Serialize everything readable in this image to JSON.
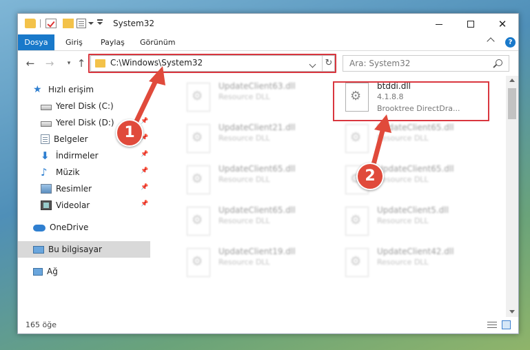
{
  "window": {
    "title": "System32",
    "min_symbol": "",
    "close_symbol": "✕"
  },
  "ribbon": {
    "tabs": [
      "Dosya",
      "Giriş",
      "Paylaş",
      "Görünüm"
    ],
    "help": "?"
  },
  "nav": {
    "back": "←",
    "forward": "→",
    "recent": "▾",
    "up": "↑",
    "address": "C:\\Windows\\System32",
    "refresh": "↻",
    "search_placeholder": "Ara: System32"
  },
  "sidebar": {
    "items": [
      {
        "label": "Hızlı erişim",
        "icon": "star-icon"
      },
      {
        "label": "Yerel Disk (C:)",
        "icon": "disk-icon"
      },
      {
        "label": "Yerel Disk (D:)",
        "icon": "disk-icon",
        "pinned": true
      },
      {
        "label": "Belgeler",
        "icon": "documents-icon",
        "pinned": true
      },
      {
        "label": "İndirmeler",
        "icon": "downloads-icon",
        "pinned": true
      },
      {
        "label": "Müzik",
        "icon": "music-icon",
        "pinned": true
      },
      {
        "label": "Resimler",
        "icon": "pictures-icon",
        "pinned": true
      },
      {
        "label": "Videolar",
        "icon": "videos-icon",
        "pinned": true
      },
      {
        "label": "OneDrive",
        "icon": "onedrive-icon"
      },
      {
        "label": "Bu bilgisayar",
        "icon": "this-pc-icon",
        "selected": true
      },
      {
        "label": "Ağ",
        "icon": "network-icon"
      }
    ],
    "pin_glyph": "📌"
  },
  "files": {
    "highlighted": {
      "name": "btddi.dll",
      "version": "4.1.8.8",
      "description": "Brooktree DirectDra..."
    },
    "left_column": [
      {
        "name": "UpdateClient63.dll",
        "type": "Resource DLL"
      },
      {
        "name": "UpdateClient21.dll",
        "type": "Resource DLL"
      },
      {
        "name": "UpdateClient65.dll",
        "type": "Resource DLL"
      },
      {
        "name": "UpdateClient65.dll",
        "type": "Resource DLL"
      },
      {
        "name": "UpdateClient19.dll",
        "type": "Resource DLL"
      }
    ],
    "right_column": [
      {
        "name": "UpdateClient65.dll",
        "type": "Resource DLL"
      },
      {
        "name": "UpdateClient65.dll",
        "type": "Resource DLL"
      },
      {
        "name": "UpdateClient5.dll",
        "type": "Resource DLL"
      },
      {
        "name": "UpdateClient42.dll",
        "type": "Resource DLL"
      }
    ]
  },
  "status": {
    "count": "165 öğe"
  },
  "callouts": {
    "one": "1",
    "two": "2"
  },
  "colors": {
    "accent": "#1979ca",
    "highlight": "#d9363e",
    "callout": "#e04a3b"
  }
}
